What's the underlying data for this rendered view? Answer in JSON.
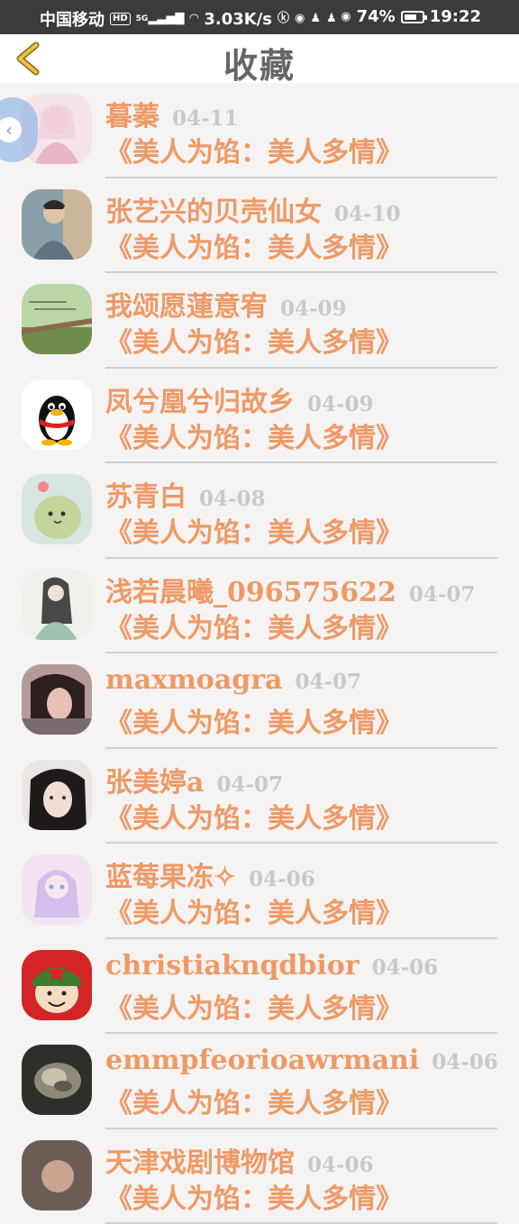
{
  "status_bar": {
    "carrier": "中国移动",
    "hd": "HD",
    "network": "5G",
    "speed": "3.03K/s",
    "battery": "74%",
    "battery_level": 0.74,
    "time": "19:22"
  },
  "header": {
    "title": "收藏",
    "back_icon": "chevron-left-icon"
  },
  "colors": {
    "accent": "#ee9a66",
    "date": "#c9c9c9",
    "back": "#e0b43a"
  },
  "items": [
    {
      "name": "暮蓁",
      "date": "04-11",
      "book": "《美人为馅：美人多情》",
      "avatar": "pink-anime-girl-avatar"
    },
    {
      "name": "张艺兴的贝壳仙女",
      "date": "04-10",
      "book": "《美人为馅：美人多情》",
      "avatar": "man-portrait-avatar"
    },
    {
      "name": "我颂愿蓮意宥",
      "date": "04-09",
      "book": "《美人为馅：美人多情》",
      "avatar": "landscape-text-avatar"
    },
    {
      "name": "凤兮凰兮归故乡",
      "date": "04-09",
      "book": "《美人为馅：美人多情》",
      "avatar": "qq-penguin-avatar"
    },
    {
      "name": "苏青白",
      "date": "04-08",
      "book": "《美人为馅：美人多情》",
      "avatar": "green-dino-avatar"
    },
    {
      "name": "浅若晨曦_096575622",
      "date": "04-07",
      "book": "《美人为馅：美人多情》",
      "avatar": "ancient-lady-avatar"
    },
    {
      "name": "maxmoagra",
      "date": "04-07",
      "book": "《美人为馅：美人多情》",
      "avatar": "girl-photo-avatar"
    },
    {
      "name": "张美婷a",
      "date": "04-07",
      "book": "《美人为馅：美人多情》",
      "avatar": "girl-selfie-avatar"
    },
    {
      "name": "蓝莓果冻✧",
      "date": "04-06",
      "book": "《美人为馅：美人多情》",
      "avatar": "pastel-anime-avatar"
    },
    {
      "name": "christiaknqdbior",
      "date": "04-06",
      "book": "《美人为馅：美人多情》",
      "avatar": "cartoon-soldier-avatar"
    },
    {
      "name": "emmpfeorioawrmani",
      "date": "04-06",
      "book": "《美人为馅：美人多情》",
      "avatar": "shell-photo-avatar"
    },
    {
      "name": "天津戏剧博物馆",
      "date": "04-06",
      "book": "《美人为馅：美人多情》",
      "avatar": "partial-photo-avatar"
    }
  ],
  "floating_button_icon": "collapse-left-icon"
}
